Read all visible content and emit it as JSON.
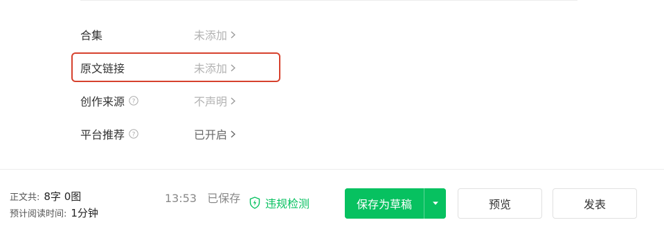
{
  "settings": [
    {
      "label": "合集",
      "value": "未添加",
      "help": false,
      "status": "off"
    },
    {
      "label": "原文链接",
      "value": "未添加",
      "help": false,
      "status": "off"
    },
    {
      "label": "创作来源",
      "value": "不声明",
      "help": true,
      "status": "off"
    },
    {
      "label": "平台推荐",
      "value": "已开启",
      "help": true,
      "status": "on"
    }
  ],
  "footer": {
    "word_count_label": "正文共:",
    "word_count_value": "8字 0图",
    "reading_time_label": "预计阅读时间:",
    "reading_time_value": "1分钟",
    "save_time": "13:53",
    "save_status": "已保存",
    "violation_check": "违规检测",
    "save_draft": "保存为草稿",
    "preview": "预览",
    "publish": "发表"
  },
  "colors": {
    "primary_green": "#07c160",
    "highlight_red": "#d6402c"
  },
  "icons": {
    "help": "question-circle-icon",
    "chevron": "chevron-right-icon",
    "shield": "shield-bolt-icon",
    "caret": "caret-down-icon"
  }
}
